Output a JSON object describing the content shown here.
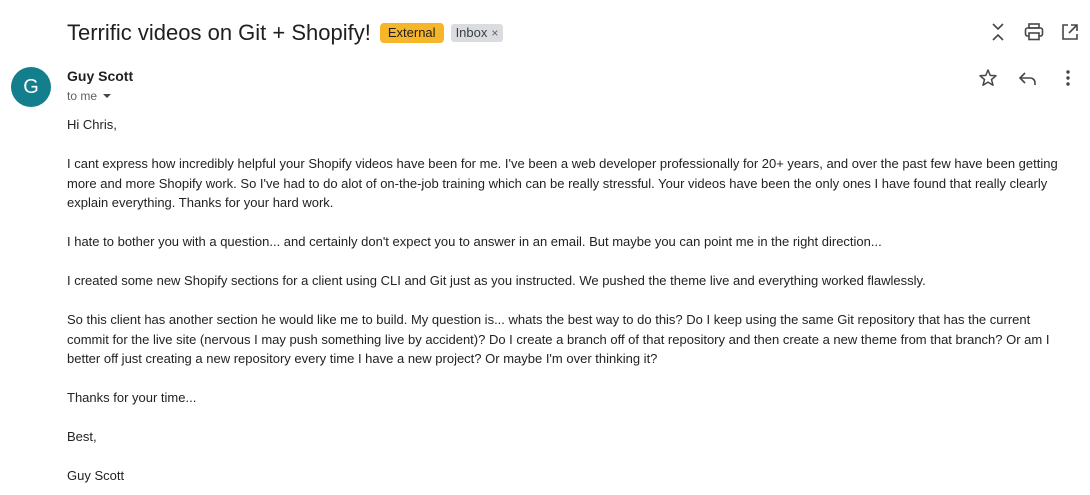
{
  "email": {
    "subject": "Terrific videos on Git + Shopify!",
    "labels": {
      "external": "External",
      "inbox": "Inbox",
      "inbox_remove": "×"
    },
    "toolbar_icons": [
      "collapse-expand-icon",
      "print-icon",
      "open-in-new-window-icon"
    ],
    "sender": {
      "avatar_letter": "G",
      "avatar_color": "#137e8c",
      "name": "Guy Scott",
      "to": "to me"
    },
    "message_icons": [
      "star-icon",
      "reply-icon",
      "more-vert-icon"
    ],
    "body": {
      "greeting": "Hi Chris,",
      "p1": "I cant express how incredibly helpful your Shopify videos have been for me. I've been a web developer professionally for 20+ years, and over the past few have been getting more and more Shopify work. So I've had to do alot of on-the-job training which can be really stressful. Your videos have been the only ones I have found that really clearly explain everything. Thanks for your hard work.",
      "p2": "I hate to bother you with a question... and certainly don't expect you to answer in an email. But maybe you can point me in the right direction...",
      "p3": "I created some new Shopify sections for a client using CLI and Git just as you instructed. We pushed the theme live and everything worked flawlessly.",
      "p4": "So this client has another section he would like me to build. My question is... whats the best way to do this? Do I keep using the same Git repository that has the current commit for the live site (nervous I may push something live by accident)? Do I create a branch off of that repository and then create a new theme from that branch? Or am I better off just creating a new repository every time I have a new project? Or maybe I'm over thinking it?",
      "p5": "Thanks for your time...",
      "closing": "Best,",
      "signature": "Guy Scott"
    }
  },
  "colors": {
    "external_badge": "#f7b529",
    "inbox_badge": "#dadce0"
  }
}
